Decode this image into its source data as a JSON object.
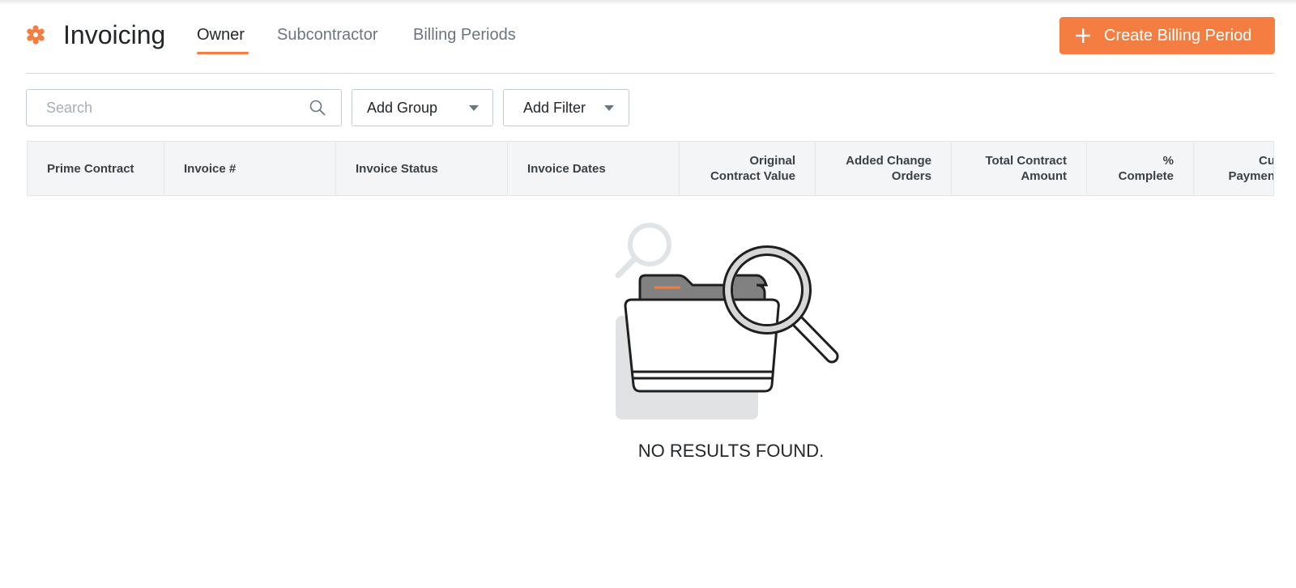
{
  "header": {
    "title": "Invoicing",
    "tabs": [
      {
        "label": "Owner",
        "active": true
      },
      {
        "label": "Subcontractor",
        "active": false
      },
      {
        "label": "Billing Periods",
        "active": false
      }
    ],
    "create_button_label": "Create Billing Period"
  },
  "toolbar": {
    "search_placeholder": "Search",
    "add_group_label": "Add Group",
    "add_filter_label": "Add Filter"
  },
  "table": {
    "columns": [
      {
        "line1": "Prime Contract",
        "line2": ""
      },
      {
        "line1": "Invoice #",
        "line2": ""
      },
      {
        "line1": "Invoice Status",
        "line2": ""
      },
      {
        "line1": "Invoice Dates",
        "line2": ""
      },
      {
        "line1": "Original",
        "line2": "Contract Value"
      },
      {
        "line1": "Added Change",
        "line2": "Orders"
      },
      {
        "line1": "Total Contract",
        "line2": "Amount"
      },
      {
        "line1": "%",
        "line2": "Complete"
      },
      {
        "line1": "Cu",
        "line2": "Paymen"
      }
    ]
  },
  "empty_state": {
    "message": "NO RESULTS FOUND."
  },
  "colors": {
    "accent": "#f47e42",
    "text": "#232729",
    "muted": "#6a767c",
    "header_bg": "#f4f5f6"
  },
  "icons": {
    "app": "gear-icon",
    "create": "plus-icon",
    "search": "search-icon",
    "dropdown": "caret-down-icon",
    "empty": "folder-magnifier-illustration"
  }
}
